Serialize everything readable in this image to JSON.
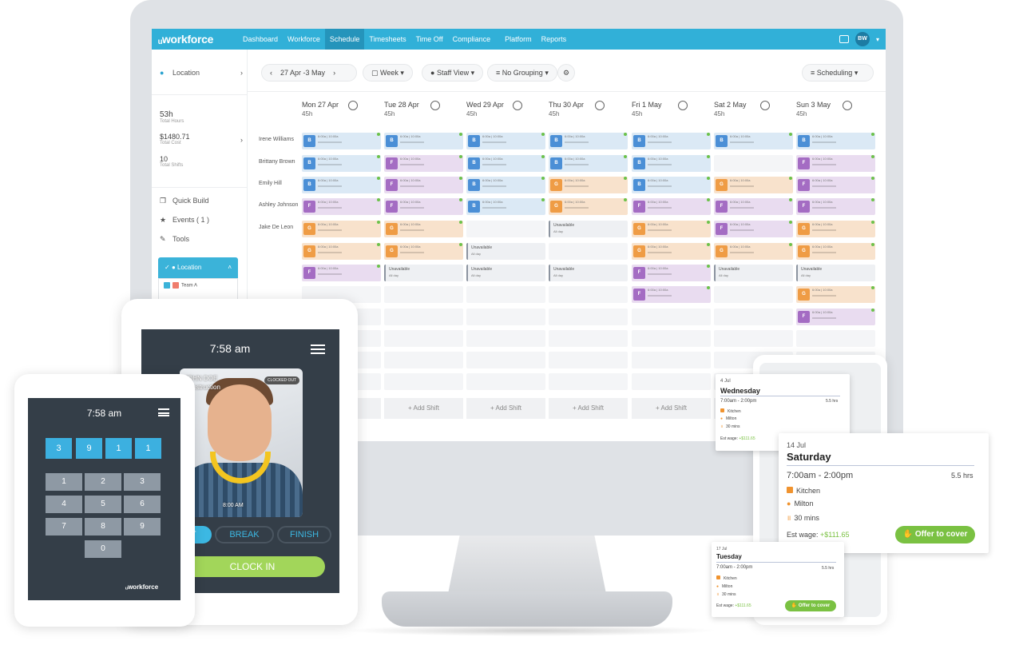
{
  "nav": {
    "logo": "workforce",
    "items": [
      "Dashboard",
      "Workforce",
      "Schedule",
      "Timesheets",
      "Time Off",
      "Compliance",
      "Platform",
      "Reports"
    ],
    "active": "Schedule",
    "avatar_initials": "BW"
  },
  "sidebar": {
    "location_label": "Location",
    "total_hours": "53h",
    "total_hours_label": "Total Hours",
    "total_cost": "$1480.71",
    "total_cost_label": "Total Cost",
    "total_shifts": "10",
    "total_shifts_label": "Total Shifts",
    "quick_build": "Quick Build",
    "events": "Events ( 1 )",
    "tools": "Tools",
    "location_panel": "Location",
    "team_a": "Team A"
  },
  "toolbar": {
    "date_range": "27 Apr -3 May",
    "week": "Week",
    "staff_view": "Staff View",
    "grouping": "No Grouping",
    "scheduling": "Scheduling"
  },
  "days": [
    {
      "label": "Mon 27 Apr",
      "hours": "45h"
    },
    {
      "label": "Tue 28 Apr",
      "hours": "45h"
    },
    {
      "label": "Wed 29 Apr",
      "hours": "45h"
    },
    {
      "label": "Thu 30 Apr",
      "hours": "45h"
    },
    {
      "label": "Fri 1 May",
      "hours": "45h"
    },
    {
      "label": "Sat 2 May",
      "hours": "45h"
    },
    {
      "label": "Sun 3 May",
      "hours": "45h"
    }
  ],
  "employees": [
    "Irene Williams",
    "Brittany Brown",
    "Emily Hill",
    "Ashley Johnson",
    "Jake De Leon"
  ],
  "shift_times": {
    "start": "6:00a",
    "end": "10:00a"
  },
  "unavailable": {
    "title": "Unavailable",
    "sub": "All day"
  },
  "grid": [
    [
      "B",
      "B",
      "B",
      "B",
      "B",
      "B",
      "B"
    ],
    [
      "B",
      "F",
      "B",
      "B",
      "B",
      "",
      "F"
    ],
    [
      "B",
      "F",
      "B",
      "G",
      "B",
      "G",
      "F"
    ],
    [
      "F",
      "F",
      "B",
      "G",
      "F",
      "F",
      "F"
    ],
    [
      "G",
      "G",
      "",
      "U",
      "G",
      "F",
      "G"
    ],
    [
      "G",
      "G",
      "U",
      "",
      "G",
      "G",
      "G"
    ],
    [
      "F",
      "U",
      "U",
      "U",
      "F",
      "U",
      "U"
    ],
    [
      "",
      "",
      "",
      "",
      "F",
      "",
      "G"
    ],
    [
      "",
      "",
      "",
      "",
      "",
      "",
      "F"
    ]
  ],
  "add_shift": "+ Add Shift",
  "add_shift_partial": "ift",
  "tablet": {
    "time": "7:58 am",
    "name": "JOHN DOE",
    "role": "Construction",
    "status": "CLOCKED OUT",
    "photo_time": "8:00 AM",
    "start": "START",
    "break": "BREAK",
    "finish": "FINISH",
    "clock_in": "CLOCK IN"
  },
  "phone": {
    "time": "7:58 am",
    "pin": [
      "3",
      "9",
      "1",
      "1"
    ],
    "keys": [
      "1",
      "2",
      "3",
      "4",
      "5",
      "6",
      "7",
      "8",
      "9",
      "0"
    ],
    "logo": "workforce"
  },
  "cards": [
    {
      "date": "4 Jul",
      "day": "Wednesday",
      "time": "7:00am - 2:00pm",
      "hrs": "5.5 hrs",
      "area": "Kitchen",
      "location": "Milton",
      "break": "30 mins",
      "wage_label": "Est wage:",
      "wage": "+$111.65"
    },
    {
      "date": "14 Jul",
      "day": "Saturday",
      "time": "7:00am - 2:00pm",
      "hrs": "5.5 hrs",
      "area": "Kitchen",
      "location": "Milton",
      "break": "30 mins",
      "wage_label": "Est wage:",
      "wage": "+$111.65",
      "offer": "Offer to cover"
    },
    {
      "date": "17 Jul",
      "day": "Tuesday",
      "time": "7:00am - 2:00pm",
      "hrs": "5.5 hrs",
      "area": "Kitchen",
      "location": "Milton",
      "break": "30 mins",
      "wage_label": "Est wage:",
      "wage": "+$111.65",
      "offer": "Offer to cover"
    }
  ]
}
